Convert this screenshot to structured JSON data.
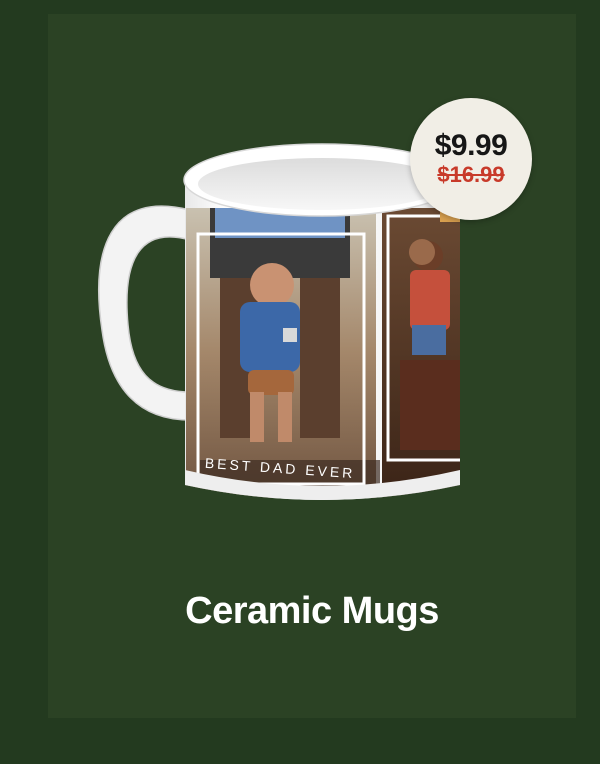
{
  "product": {
    "title": "Ceramic Mugs",
    "image_caption": "BEST DAD EVER"
  },
  "price": {
    "current": "$9.99",
    "original": "$16.99"
  },
  "colors": {
    "background": "#233a1f",
    "card": "#2b4224",
    "badge": "#f1eee6",
    "original_price": "#c83a2a"
  }
}
